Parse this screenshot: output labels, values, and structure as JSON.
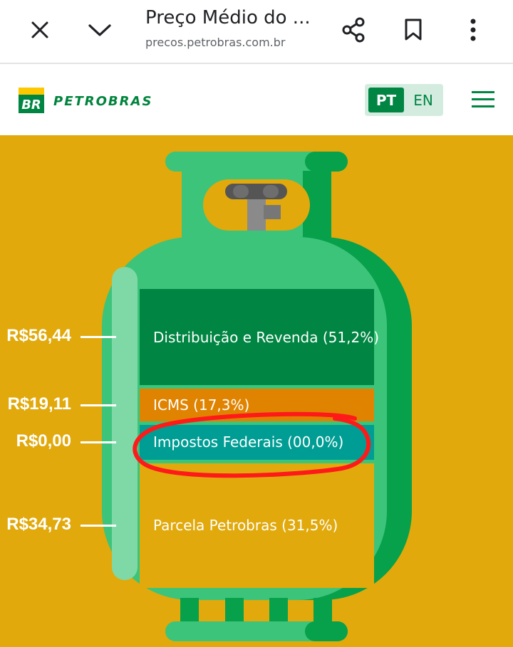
{
  "browser": {
    "page_title": "Preço Médio do ...",
    "url": "precos.petrobras.com.br",
    "icons": [
      "close-icon",
      "chevron-down-icon",
      "share-icon",
      "bookmark-icon",
      "more-vert-icon"
    ]
  },
  "site": {
    "logo_badge": "BR",
    "logo_name": "PETROBRAS",
    "lang_active": "PT",
    "lang_other": "EN",
    "menu_icon": "hamburger-icon"
  },
  "colors": {
    "background": "#e1a90b",
    "cylinder": "#3cc47a",
    "distribuicao": "#008542",
    "icms": "#e08300",
    "impostos_federais": "#009d94",
    "parcela_petrobras": "#e1a90b",
    "annotation": "#ff1a1a"
  },
  "breakdown": [
    {
      "price": "R$56,44",
      "label": "Distribuição e Revenda (51,2%)",
      "percent": 51.2
    },
    {
      "price": "R$19,11",
      "label": "ICMS (17,3%)",
      "percent": 17.3
    },
    {
      "price": "R$0,00",
      "label": "Impostos Federais (00,0%)",
      "percent": 0.0
    },
    {
      "price": "R$34,73",
      "label": "Parcela Petrobras (31,5%)",
      "percent": 31.5
    }
  ]
}
